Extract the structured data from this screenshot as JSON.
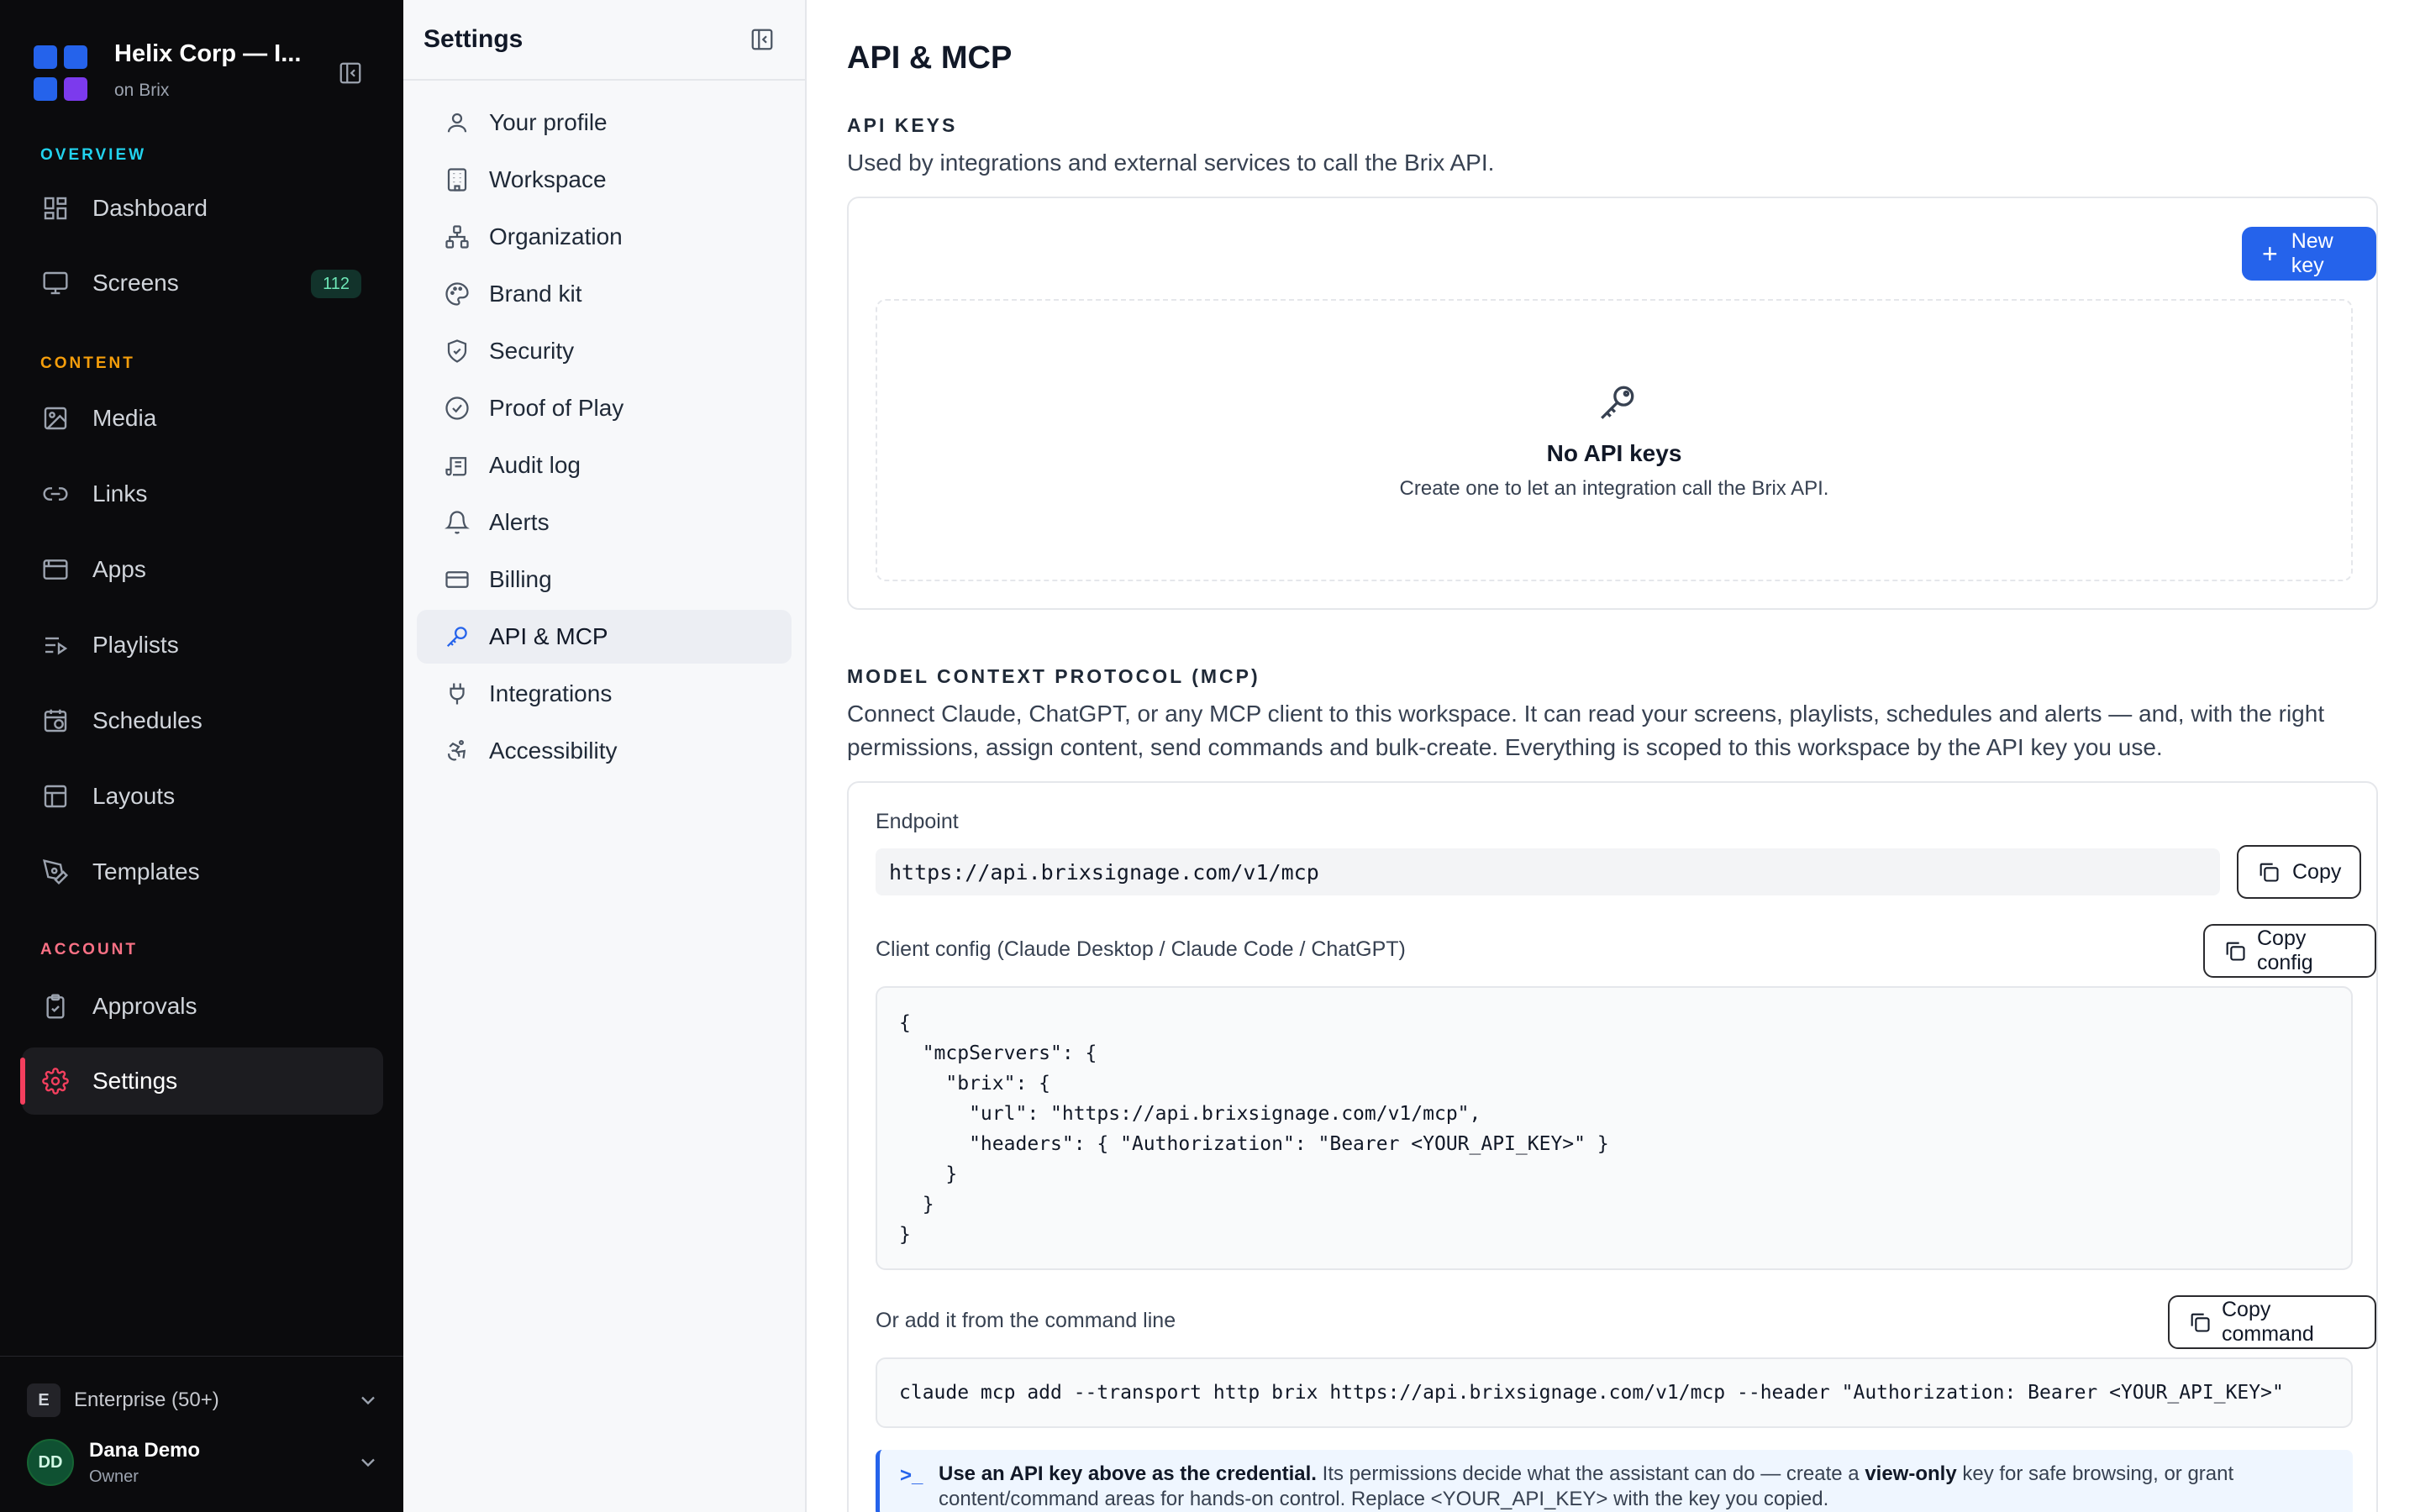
{
  "nav": {
    "org_name": "Helix Corp — I...",
    "org_sub": "on Brix",
    "colors": {
      "overview": "#22d3ee",
      "content": "#f59e0b",
      "account": "#fb7185",
      "active_accent": "#f43f5e",
      "logo_blue": "#2563eb",
      "logo_purple": "#7c3aed"
    },
    "sections": {
      "overview": "OVERVIEW",
      "content": "CONTENT",
      "account": "ACCOUNT"
    },
    "items": {
      "dashboard": {
        "label": "Dashboard",
        "icon": "dashboard-icon"
      },
      "screens": {
        "label": "Screens",
        "icon": "monitor-icon",
        "badge": "112"
      },
      "media": {
        "label": "Media",
        "icon": "image-icon"
      },
      "links": {
        "label": "Links",
        "icon": "link-icon"
      },
      "apps": {
        "label": "Apps",
        "icon": "app-window-icon"
      },
      "playlists": {
        "label": "Playlists",
        "icon": "playlist-icon"
      },
      "schedules": {
        "label": "Schedules",
        "icon": "calendar-clock-icon"
      },
      "layouts": {
        "label": "Layouts",
        "icon": "layout-icon"
      },
      "templates": {
        "label": "Templates",
        "icon": "pen-tool-icon"
      },
      "approvals": {
        "label": "Approvals",
        "icon": "clipboard-check-icon"
      },
      "settings": {
        "label": "Settings",
        "icon": "gear-icon"
      }
    },
    "plan": {
      "letter": "E",
      "label": "Enterprise (50+)"
    },
    "user": {
      "initials": "DD",
      "name": "Dana Demo",
      "role": "Owner"
    }
  },
  "subnav": {
    "title": "Settings",
    "items": [
      {
        "label": "Your profile",
        "icon": "user-icon"
      },
      {
        "label": "Workspace",
        "icon": "building-icon"
      },
      {
        "label": "Organization",
        "icon": "org-chart-icon"
      },
      {
        "label": "Brand kit",
        "icon": "palette-icon"
      },
      {
        "label": "Security",
        "icon": "shield-icon"
      },
      {
        "label": "Proof of Play",
        "icon": "check-circle-icon"
      },
      {
        "label": "Audit log",
        "icon": "scroll-icon"
      },
      {
        "label": "Alerts",
        "icon": "bell-icon"
      },
      {
        "label": "Billing",
        "icon": "credit-card-icon"
      },
      {
        "label": "API & MCP",
        "icon": "key-icon"
      },
      {
        "label": "Integrations",
        "icon": "plug-icon"
      },
      {
        "label": "Accessibility",
        "icon": "accessibility-icon"
      }
    ]
  },
  "main": {
    "title": "API & MCP",
    "api_keys": {
      "heading": "API KEYS",
      "description": "Used by integrations and external services to call the Brix API.",
      "new_key_label": "New key",
      "empty_title": "No API keys",
      "empty_sub": "Create one to let an integration call the Brix API."
    },
    "mcp": {
      "heading": "MODEL CONTEXT PROTOCOL (MCP)",
      "description": "Connect Claude, ChatGPT, or any MCP client to this workspace. It can read your screens, playlists, schedules and alerts — and, with the right permissions, assign content, send commands and bulk-create. Everything is scoped to this workspace by the API key you use.",
      "endpoint_label": "Endpoint",
      "endpoint_value": "https://api.brixsignage.com/v1/mcp",
      "copy_label": "Copy",
      "config_label": "Client config (Claude Desktop / Claude Code / ChatGPT)",
      "copy_config_label": "Copy config",
      "config_code": "{\n  \"mcpServers\": {\n    \"brix\": {\n      \"url\": \"https://api.brixsignage.com/v1/mcp\",\n      \"headers\": { \"Authorization\": \"Bearer <YOUR_API_KEY>\" }\n    }\n  }\n}",
      "cli_label": "Or add it from the command line",
      "copy_command_label": "Copy command",
      "cli_code": "claude mcp add --transport http brix https://api.brixsignage.com/v1/mcp --header \"Authorization: Bearer <YOUR_API_KEY>\"",
      "note_bold": "Use an API key above as the credential.",
      "note_text": " Its permissions decide what the assistant can do — create a ",
      "note_bold2": "view-only",
      "note_text2": " key for safe browsing, or grant content/command areas for hands-on control. Replace <YOUR_API_KEY> with the key you copied."
    }
  }
}
